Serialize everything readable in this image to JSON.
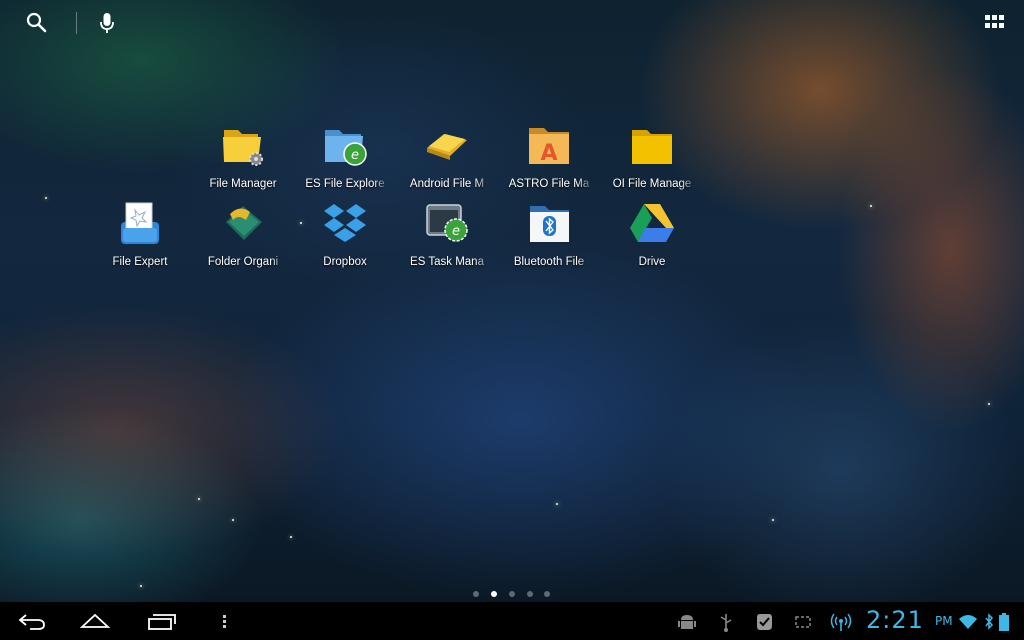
{
  "top_bar": {
    "search_icon": "search-icon",
    "voice_icon": "mic-icon",
    "all_apps_icon": "grid-icon"
  },
  "home": {
    "row1": [
      {
        "label": "File Manager",
        "icon": "folder-gear-icon"
      },
      {
        "label": "ES File Explore",
        "icon": "es-folder-icon"
      },
      {
        "label": "Android File M",
        "icon": "android-folder-icon"
      },
      {
        "label": "ASTRO File Ma",
        "icon": "astro-folder-icon"
      },
      {
        "label": "OI File Manage",
        "icon": "yellow-folder-icon"
      }
    ],
    "row2": [
      {
        "label": "File Expert",
        "icon": "file-expert-icon"
      },
      {
        "label": "Folder Organi",
        "icon": "folder-organizer-icon"
      },
      {
        "label": "Dropbox",
        "icon": "dropbox-icon"
      },
      {
        "label": "ES Task Mana",
        "icon": "es-task-icon"
      },
      {
        "label": "Bluetooth File",
        "icon": "bluetooth-folder-icon"
      },
      {
        "label": "Drive",
        "icon": "drive-icon"
      }
    ]
  },
  "page_indicator": {
    "pages": 5,
    "current": 2
  },
  "navbar": {
    "back_icon": "back-icon",
    "home_icon": "home-icon",
    "recents_icon": "recents-icon",
    "menu_icon": "overflow-menu-icon"
  },
  "status": {
    "time": "2:21",
    "ampm": "PM",
    "icons": [
      "android-debug-icon",
      "usb-icon",
      "check-icon",
      "screen-icon",
      "hotspot-icon",
      "wifi-icon",
      "bluetooth-icon",
      "battery-icon"
    ]
  },
  "colors": {
    "clock": "#3fb7e6",
    "navbar": "#000000"
  }
}
